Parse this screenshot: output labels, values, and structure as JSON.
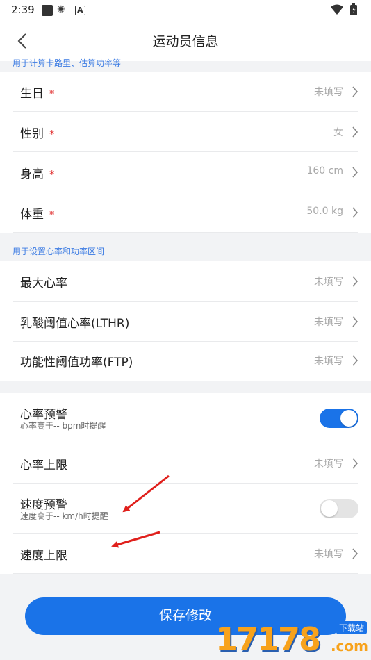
{
  "status_bar": {
    "time": "2:39"
  },
  "header": {
    "title": "运动员信息"
  },
  "section1": {
    "note": "用于计算卡路里、估算功率等",
    "rows": [
      {
        "label": "生日",
        "required": "*",
        "value": "未填写"
      },
      {
        "label": "性别",
        "required": "*",
        "value": "女"
      },
      {
        "label": "身高",
        "required": "*",
        "value": "160 cm"
      },
      {
        "label": "体重",
        "required": "*",
        "value": "50.0 kg"
      }
    ]
  },
  "section2": {
    "note": "用于设置心率和功率区间",
    "rows": [
      {
        "label": "最大心率",
        "value": "未填写"
      },
      {
        "label": "乳酸阈值心率(LTHR)",
        "value": "未填写"
      },
      {
        "label": "功能性阈值功率(FTP)",
        "value": "未填写"
      }
    ]
  },
  "section3": {
    "heart_rate_alert": {
      "label": "心率预警",
      "sublabel": "心率高于-- bpm时提醒",
      "enabled": true
    },
    "heart_rate_limit": {
      "label": "心率上限",
      "value": "未填写"
    },
    "speed_alert": {
      "label": "速度预警",
      "sublabel": "速度高于-- km/h时提醒",
      "enabled": false
    },
    "speed_limit": {
      "label": "速度上限",
      "value": "未填写"
    }
  },
  "save_label": "保存修改",
  "watermark": {
    "text": "17178",
    "sub": "下载站",
    "domain": ".com"
  },
  "colors": {
    "accent": "#1a73e8",
    "required": "#e02d2d",
    "note": "#3b7be3",
    "annotation": "#e0201c"
  }
}
